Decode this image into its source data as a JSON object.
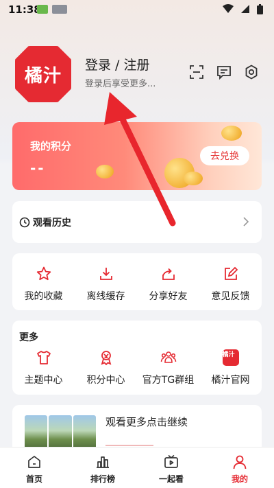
{
  "status_bar": {
    "time": "11:38",
    "icons": [
      "app-notification-icon",
      "hms-icon",
      "wifi-icon",
      "signal-icon",
      "battery-icon"
    ]
  },
  "profile": {
    "logo_text": "橘汁",
    "login_title": "登录 / 注册",
    "login_subtitle": "登录后享受更多...",
    "icons": [
      "scan-icon",
      "message-icon",
      "settings-icon"
    ]
  },
  "points": {
    "title": "我的积分",
    "value": "--",
    "exchange_label": "去兑换"
  },
  "history": {
    "label": "观看历史"
  },
  "actions": {
    "items": [
      {
        "label": "我的收藏",
        "icon": "star-icon"
      },
      {
        "label": "离线缓存",
        "icon": "download-icon"
      },
      {
        "label": "分享好友",
        "icon": "share-icon"
      },
      {
        "label": "意见反馈",
        "icon": "feedback-edit-icon"
      }
    ]
  },
  "more": {
    "title": "更多",
    "items": [
      {
        "label": "主题中心",
        "icon": "tshirt-icon"
      },
      {
        "label": "积分中心",
        "icon": "medal-icon"
      },
      {
        "label": "官方TG群组",
        "icon": "group-icon"
      },
      {
        "label": "橘汁官网",
        "icon": "brand-icon",
        "icon_text": "橘汁"
      }
    ]
  },
  "continue_watch": {
    "text": "观看更多点击继续"
  },
  "tabs": [
    {
      "label": "首页",
      "icon": "home-icon",
      "active": false
    },
    {
      "label": "排行榜",
      "icon": "ranking-icon",
      "active": false
    },
    {
      "label": "一起看",
      "icon": "tv-icon",
      "active": false
    },
    {
      "label": "我的",
      "icon": "person-icon",
      "active": true
    }
  ],
  "colors": {
    "brand_red": "#e52a32",
    "accent_red": "#e63a3a",
    "arrow_red": "#e8262d"
  }
}
